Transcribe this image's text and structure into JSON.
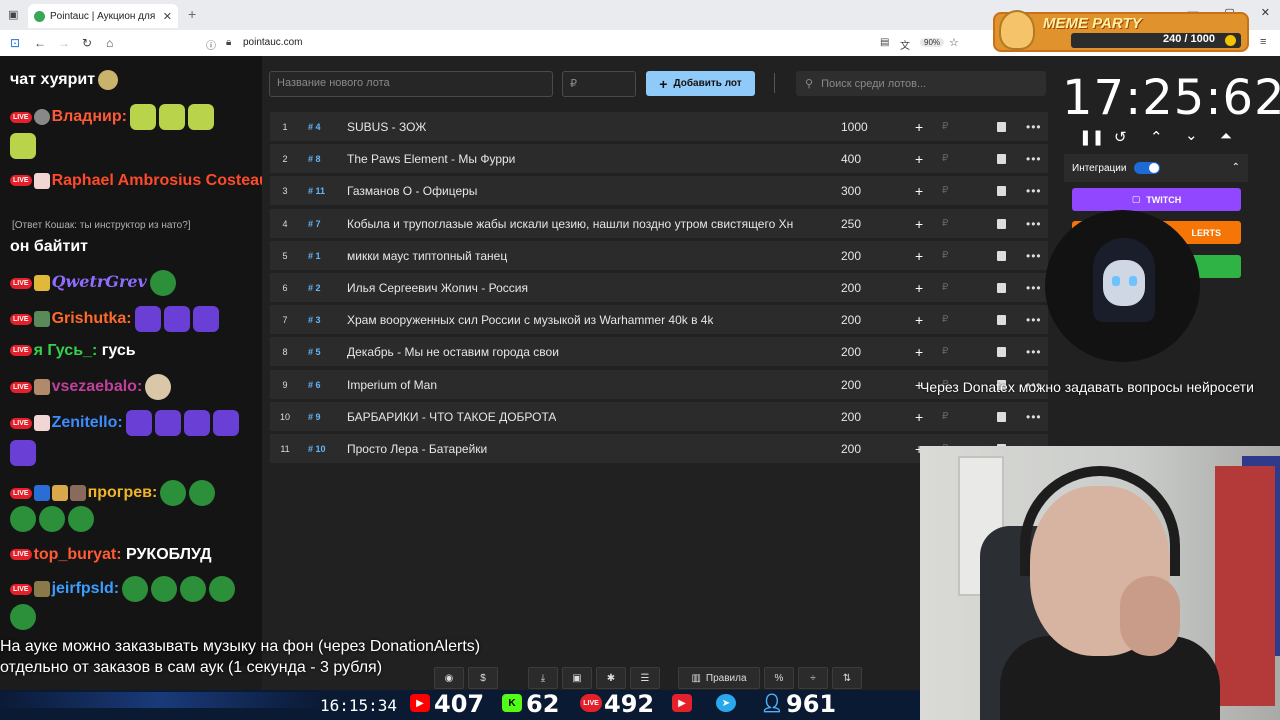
{
  "browser": {
    "tab_title": "Pointauc | Аукцион для стримеров",
    "url": "pointauc.com",
    "zoom": "90%"
  },
  "meme_party": {
    "title": "MEME PARTY",
    "counter": "240 / 1000"
  },
  "chat": {
    "messages": [
      {
        "user": "",
        "text": "чат хуярит"
      },
      {
        "user": "Владнир:",
        "text": ""
      },
      {
        "user": "Raphael Ambrosius Costeau:",
        "text": ""
      },
      {
        "reply": "[Ответ Кошак: ты инструктор из нато?]"
      },
      {
        "user": "",
        "text": "он байтит"
      },
      {
        "user": "QwetrGrev",
        "text": ""
      },
      {
        "user": "Grishutka:",
        "text": ""
      },
      {
        "user": "я Гусь_:",
        "text": "гусь"
      },
      {
        "user": "vsezaebalo:",
        "text": ""
      },
      {
        "user": "Zenitello:",
        "text": ""
      },
      {
        "user": "прогрев:",
        "text": ""
      },
      {
        "user": "top_buryat:",
        "text": "РУКОБЛУД"
      },
      {
        "user": "jeirfpsld:",
        "text": ""
      }
    ]
  },
  "lot_form": {
    "name_placeholder": "Название нового лота",
    "amount_placeholder": "₽",
    "add_button": "Добавить лот",
    "search_placeholder": "Поиск среди лотов..."
  },
  "lots": [
    {
      "num": "1",
      "id": "# 4",
      "name": "SUBUS - ЗОЖ",
      "amount": "1000"
    },
    {
      "num": "2",
      "id": "# 8",
      "name": "The Paws Element - Мы Фурри",
      "amount": "400"
    },
    {
      "num": "3",
      "id": "# 11",
      "name": "Газманов О - Офицеры",
      "amount": "300"
    },
    {
      "num": "4",
      "id": "# 7",
      "name": "Кобыла и трупоглазые жабы искали цезию, нашли поздно утром свистящего Хн",
      "amount": "250"
    },
    {
      "num": "5",
      "id": "# 1",
      "name": "микки маус типтопный танец",
      "amount": "200"
    },
    {
      "num": "6",
      "id": "# 2",
      "name": "Илья Сергеевич Жопич - Россия",
      "amount": "200"
    },
    {
      "num": "7",
      "id": "# 3",
      "name": "Храм вооруженных сил России с музыкой из Warhammer 40k в 4k",
      "amount": "200"
    },
    {
      "num": "8",
      "id": "# 5",
      "name": "Декабрь - Мы не оставим города свои",
      "amount": "200"
    },
    {
      "num": "9",
      "id": "# 6",
      "name": "Imperium of Man",
      "amount": "200"
    },
    {
      "num": "10",
      "id": "# 9",
      "name": "БАРБАРИКИ - ЧТО ТАКОЕ ДОБРОТА",
      "amount": "200"
    },
    {
      "num": "11",
      "id": "# 10",
      "name": "Просто Лера - Батарейки",
      "amount": "200"
    }
  ],
  "timer": {
    "value": "17:25:62"
  },
  "integrations": {
    "label": "Интеграции",
    "twitch": "TWITCH",
    "alerts": "LERTS"
  },
  "ticker": "Через Donatex можно задавать вопросы нейросети",
  "subtitle": {
    "line1": "На ауке можно заказывать музыку на фон (через DonationAlerts)",
    "line2": "отдельно от заказов в сам аук (1 секунда - 3 рубля)"
  },
  "dock": {
    "rules": "Правила",
    "dollar": "$",
    "percent": "%"
  },
  "stats": {
    "clock": "16:15:34",
    "youtube": "407",
    "kick": "62",
    "live": "492",
    "telegram": "",
    "viewers": "961"
  },
  "colors": {
    "accent": "#90caf9",
    "twitch": "#9146ff",
    "donationalerts": "#f57507",
    "green": "#2fb344",
    "live_red": "#e4202a"
  }
}
